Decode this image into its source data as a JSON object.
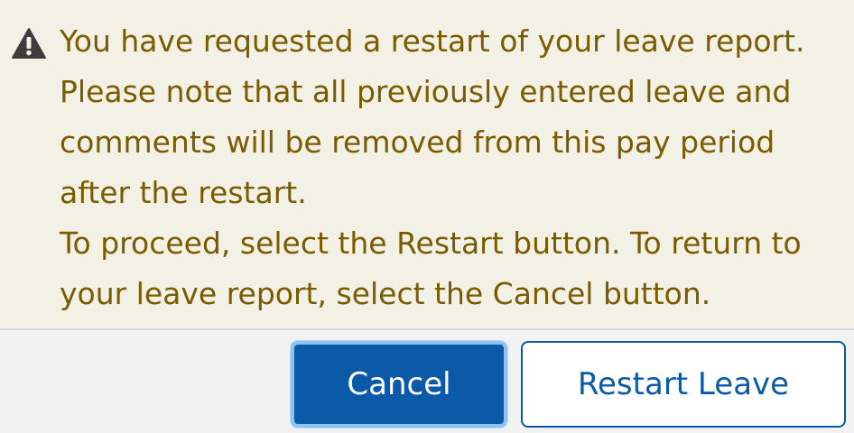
{
  "warning": {
    "icon": "warning-triangle-icon",
    "text_color": "#7a5c00",
    "background": "#f3f0e6",
    "paragraph_1": "You have requested a restart of your leave report. Please note that all previously entered leave and comments will be removed from this pay period after the restart.",
    "paragraph_2": "To proceed, select the Restart button. To return to your leave report, select the Cancel button."
  },
  "buttons": {
    "cancel_label": "Cancel",
    "restart_label": "Restart Leave",
    "primary_color": "#0b5aa7"
  }
}
